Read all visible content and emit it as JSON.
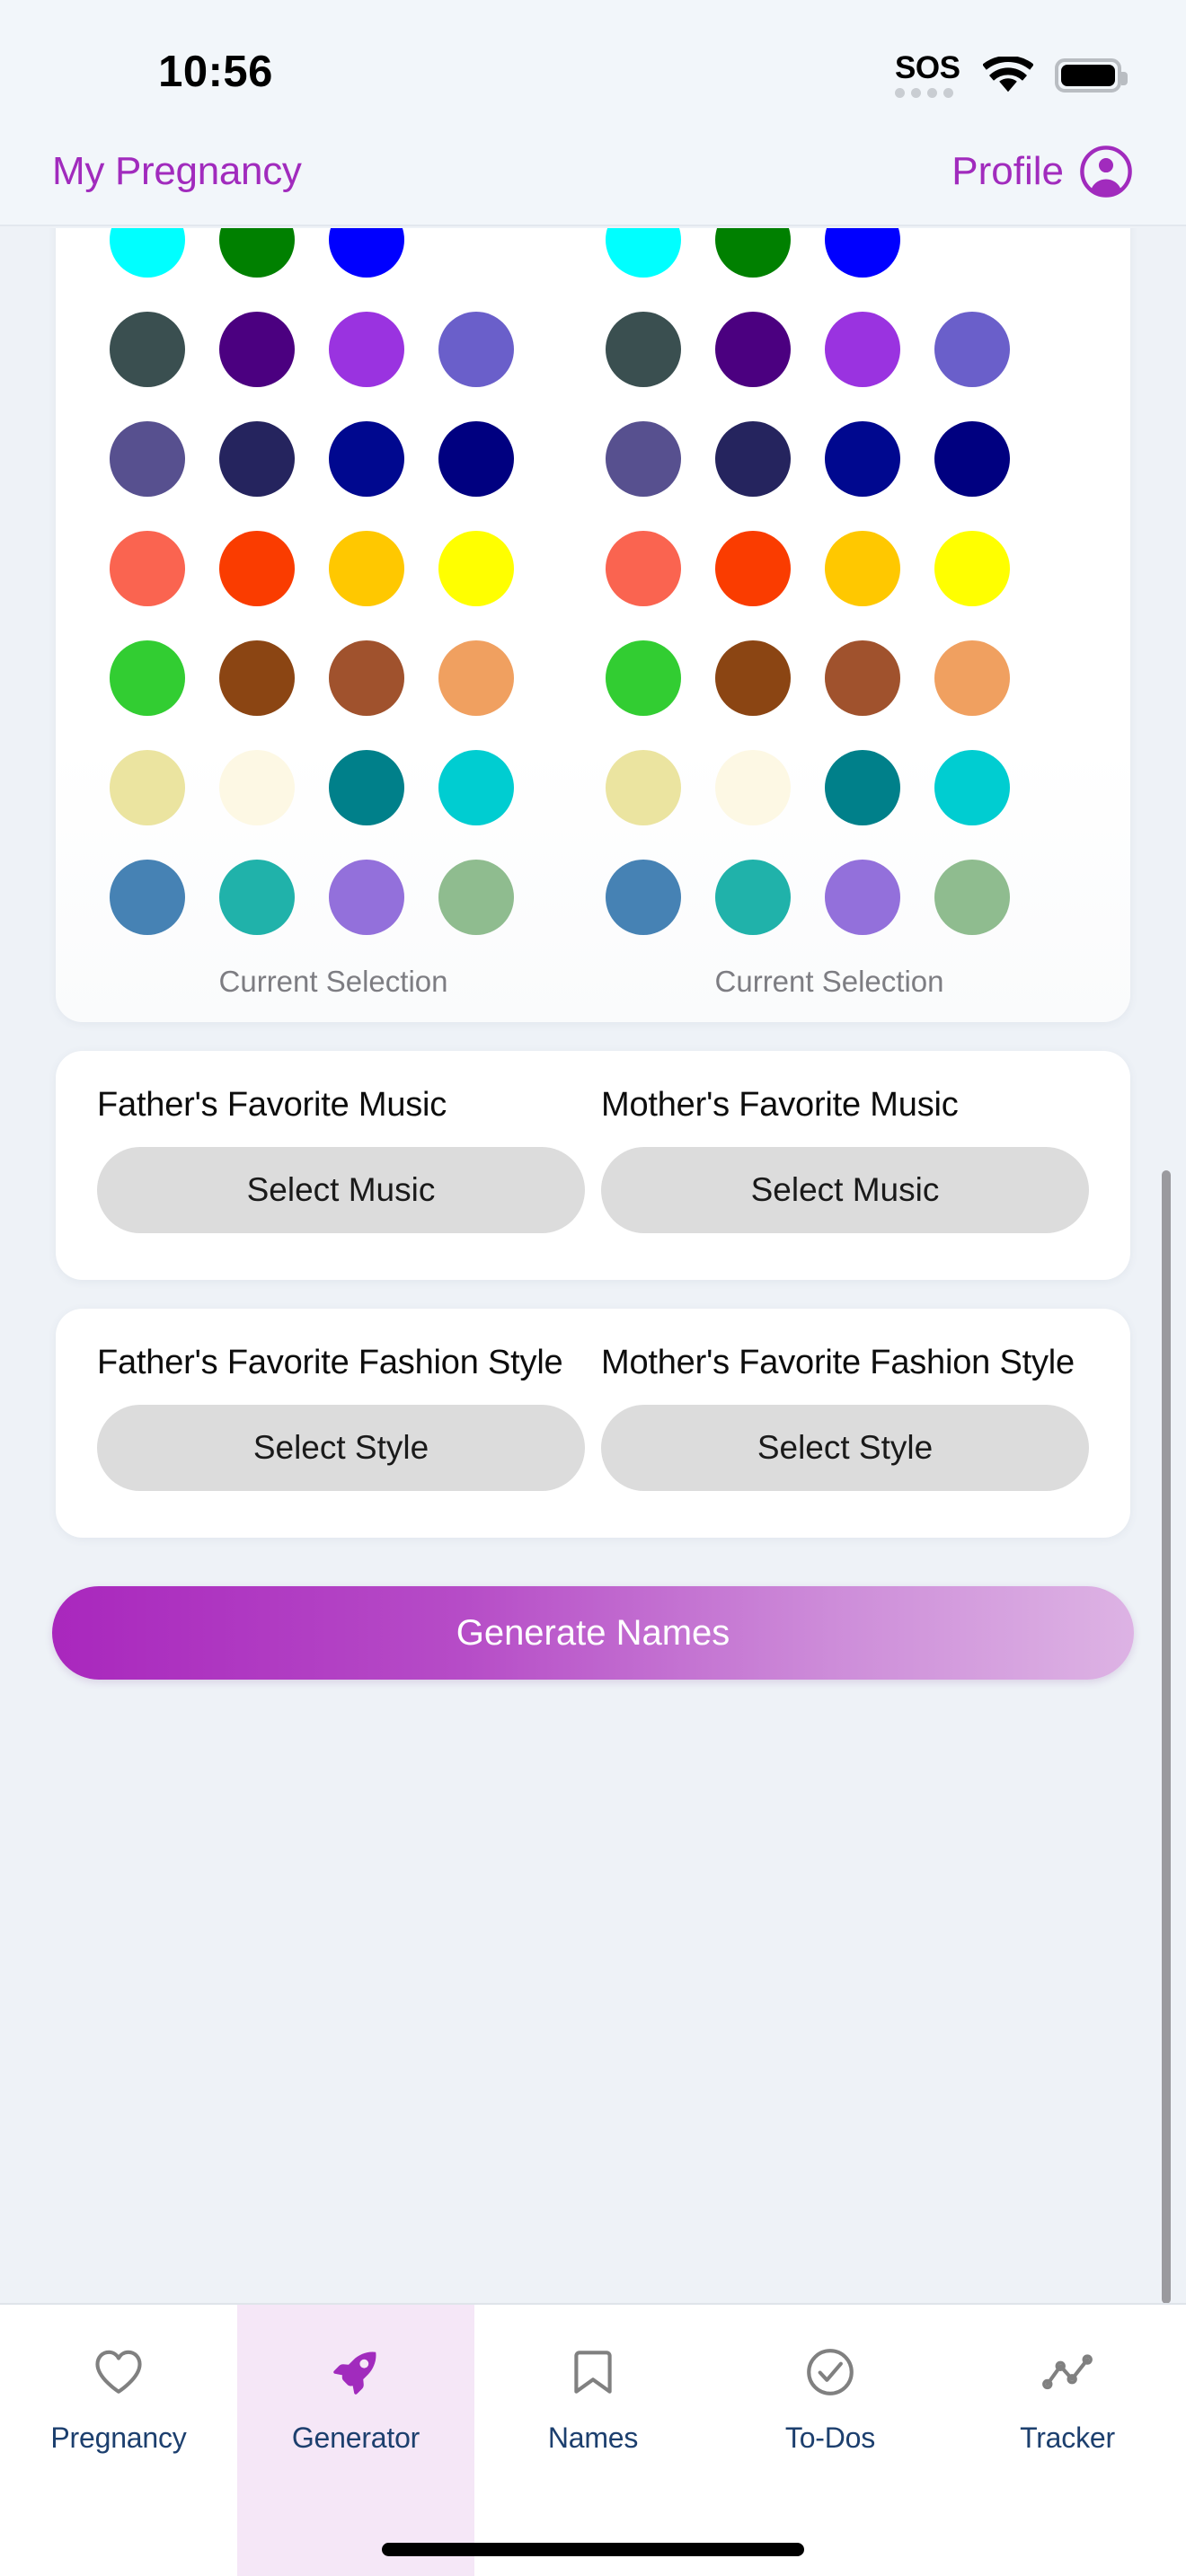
{
  "status_bar": {
    "time": "10:56",
    "sos_label": "SOS",
    "wifi_icon": "wifi-icon",
    "battery_icon": "battery-full-icon",
    "sos_dot_count": 4
  },
  "header": {
    "title": "My Pregnancy",
    "profile_label": "Profile",
    "profile_icon": "person-circle-icon",
    "accent_color": "#a12bbd"
  },
  "color_card": {
    "columns": [
      {
        "caption": "Current Selection",
        "swatches": [
          "#a32cc0",
          "#d9b6e8",
          "#f08fad",
          "#7d0b7a",
          "#00ffff",
          "#008000",
          "#0000ff",
          "",
          "#3a4f50",
          "#4b0080",
          "#9a33e0",
          "#6a5fca",
          "#57508f",
          "#25245e",
          "#00088f",
          "#000080",
          "#fa6450",
          "#fa3c00",
          "#ffc800",
          "#ffff00",
          "#32cd32",
          "#8b4513",
          "#a0522d",
          "#f0a060",
          "#ebe4a0",
          "#fdf8e4",
          "#00808a",
          "#00cdd1",
          "#4682b4",
          "#20b2aa",
          "#9370db",
          "#8fbc8f"
        ]
      },
      {
        "caption": "Current Selection",
        "swatches": [
          "#a32cc0",
          "#d9b6e8",
          "#f08fad",
          "#7d0b7a",
          "#00ffff",
          "#008000",
          "#0000ff",
          "",
          "#3a4f50",
          "#4b0080",
          "#9a33e0",
          "#6a5fca",
          "#57508f",
          "#25245e",
          "#00088f",
          "#000080",
          "#fa6450",
          "#fa3c00",
          "#ffc800",
          "#ffff00",
          "#32cd32",
          "#8b4513",
          "#a0522d",
          "#f0a060",
          "#ebe4a0",
          "#fdf8e4",
          "#00808a",
          "#00cdd1",
          "#4682b4",
          "#20b2aa",
          "#9370db",
          "#8fbc8f"
        ]
      }
    ]
  },
  "music_card": {
    "father_label": "Father's Favorite Music",
    "father_button": "Select Music",
    "mother_label": "Mother's Favorite Music",
    "mother_button": "Select Music"
  },
  "fashion_card": {
    "father_label": "Father's Favorite Fashion Style",
    "father_button": "Select Style",
    "mother_label": "Mother's Favorite Fashion Style",
    "mother_button": "Select Style"
  },
  "generate": {
    "label": "Generate Names",
    "gradient_from": "#a927bd",
    "gradient_to": "#ddb3e4"
  },
  "tab_bar": {
    "active_index": 1,
    "active_color": "#a12bbd",
    "inactive_icon_color": "#808080",
    "label_color": "#1c3f6e",
    "items": [
      {
        "label": "Pregnancy",
        "icon": "heart-icon"
      },
      {
        "label": "Generator",
        "icon": "rocket-icon"
      },
      {
        "label": "Names",
        "icon": "bookmark-icon"
      },
      {
        "label": "To-Dos",
        "icon": "check-circle-icon"
      },
      {
        "label": "Tracker",
        "icon": "chart-line-icon"
      }
    ]
  }
}
